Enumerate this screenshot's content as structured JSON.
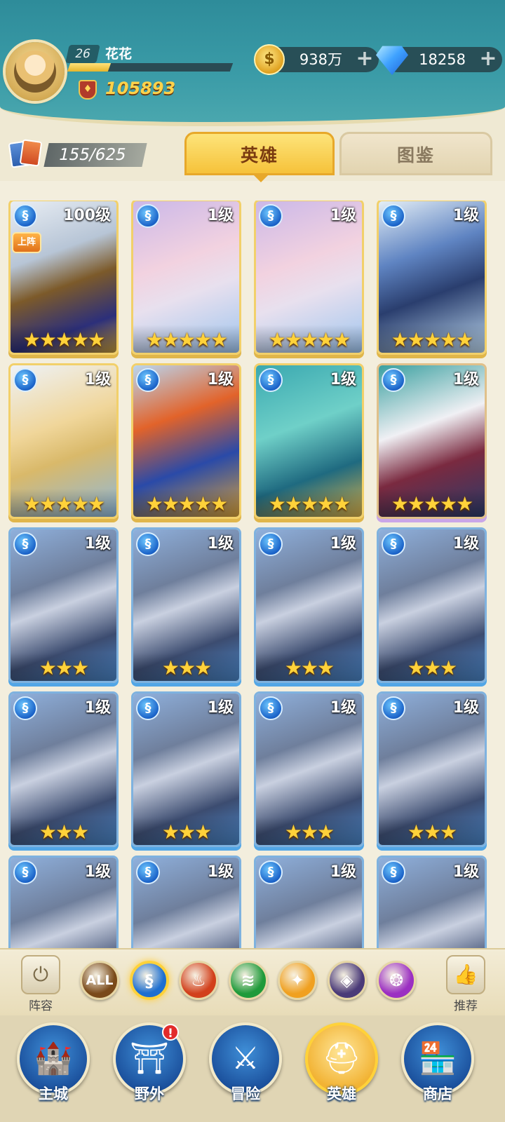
{
  "player": {
    "level": "26",
    "name": "花花",
    "xp_fraction": 0.25,
    "power": "105893"
  },
  "resources": {
    "gold": "938万",
    "gems": "18258"
  },
  "hero_count": "155/625",
  "tabs": [
    "英雄",
    "图鉴"
  ],
  "active_tab": "英雄",
  "heroes": [
    {
      "level": "100级",
      "stars": "★★★★★",
      "badge": "上阵",
      "palette": "gold-hooded"
    },
    {
      "level": "1级",
      "stars": "★★★★★",
      "palette": "pink-girl"
    },
    {
      "level": "1级",
      "stars": "★★★★★",
      "palette": "pink-girl"
    },
    {
      "level": "1级",
      "stars": "★★★★★",
      "palette": "blue-hood"
    },
    {
      "level": "1级",
      "stars": "★★★★★",
      "palette": "blonde-veil"
    },
    {
      "level": "1级",
      "stars": "★★★★★",
      "palette": "red-hair"
    },
    {
      "level": "1级",
      "stars": "★★★★★",
      "palette": "sea-witch"
    },
    {
      "level": "1级",
      "stars": "★★★★★",
      "palette": "cat-pirate"
    },
    {
      "level": "1级",
      "stars": "★★★",
      "palette": "knight"
    },
    {
      "level": "1级",
      "stars": "★★★",
      "palette": "knight"
    },
    {
      "level": "1级",
      "stars": "★★★",
      "palette": "knight"
    },
    {
      "level": "1级",
      "stars": "★★★",
      "palette": "knight"
    },
    {
      "level": "1级",
      "stars": "★★★",
      "palette": "knight"
    },
    {
      "level": "1级",
      "stars": "★★★",
      "palette": "knight"
    },
    {
      "level": "1级",
      "stars": "★★★",
      "palette": "knight"
    },
    {
      "level": "1级",
      "stars": "★★★",
      "palette": "knight"
    },
    {
      "level": "1级",
      "stars": "",
      "palette": "knight"
    },
    {
      "level": "1级",
      "stars": "",
      "palette": "knight"
    },
    {
      "level": "1级",
      "stars": "",
      "palette": "knight"
    },
    {
      "level": "1级",
      "stars": "",
      "palette": "knight"
    }
  ],
  "filters": {
    "lineup_label": "阵容",
    "recommend_label": "推荐",
    "factions": [
      {
        "name": "all",
        "label": "ALL",
        "color": "#7a4a1a"
      },
      {
        "name": "water",
        "label": "",
        "color": "#1e6fd0",
        "active": true
      },
      {
        "name": "fire",
        "label": "",
        "color": "#d2401c"
      },
      {
        "name": "wind",
        "label": "",
        "color": "#1f9a3a"
      },
      {
        "name": "light",
        "label": "",
        "color": "#f0a020"
      },
      {
        "name": "shadow",
        "label": "",
        "color": "#4a3a78"
      },
      {
        "name": "arcane",
        "label": "",
        "color": "#9b2fc2"
      }
    ]
  },
  "nav": [
    {
      "label": "主城",
      "icon": "castle-icon"
    },
    {
      "label": "野外",
      "icon": "portal-icon",
      "alert": "!"
    },
    {
      "label": "冒险",
      "icon": "sword-icon"
    },
    {
      "label": "英雄",
      "icon": "helmet-icon",
      "active": true
    },
    {
      "label": "商店",
      "icon": "shop-icon"
    }
  ]
}
